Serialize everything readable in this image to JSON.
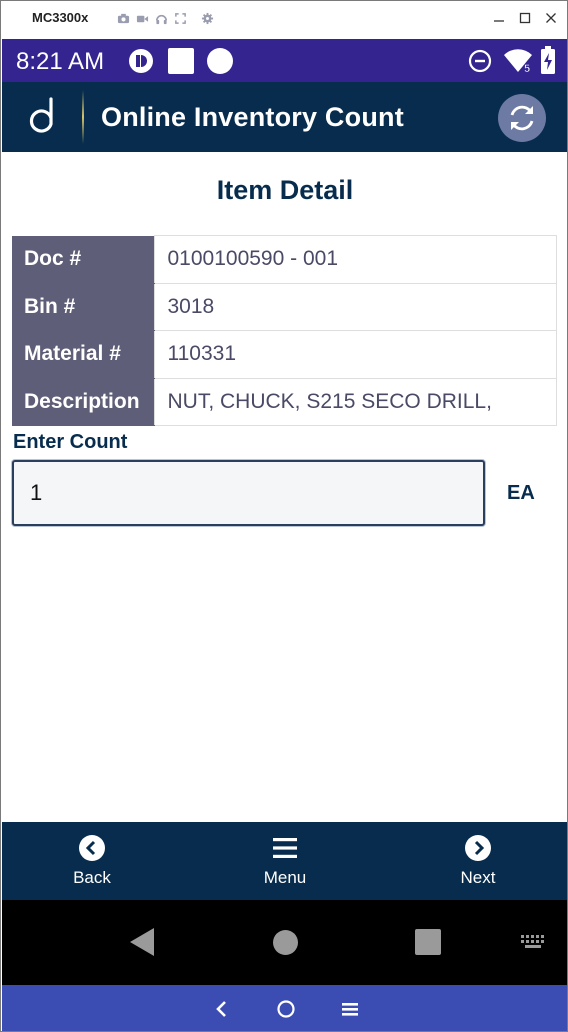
{
  "window": {
    "title": "MC3300x",
    "tools": [
      "camera-icon",
      "video-icon",
      "headphones-icon",
      "fullscreen-icon",
      "settings-icon"
    ],
    "controls": [
      "minimize-icon",
      "maximize-icon",
      "close-icon"
    ]
  },
  "status_bar": {
    "time": "8:21 AM",
    "battery_level": "5"
  },
  "header": {
    "title": "Online Inventory Count",
    "refresh_icon": "refresh-icon"
  },
  "page": {
    "title": "Item Detail",
    "details": [
      {
        "label": "Doc #",
        "value": "0100100590 - 001"
      },
      {
        "label": "Bin #",
        "value": "3018"
      },
      {
        "label": "Material #",
        "value": "110331"
      },
      {
        "label": "Description",
        "value": "NUT, CHUCK, S215 SECO DRILL,"
      }
    ],
    "count_label": "Enter Count",
    "count_value": "1",
    "uom": "EA"
  },
  "bottom_nav": {
    "back": "Back",
    "menu": "Menu",
    "next": "Next"
  },
  "colors": {
    "status_bar": "#33248f",
    "header": "#072c4d",
    "label_cell": "#5e5e78",
    "emulator_bar": "#3b4db3"
  }
}
